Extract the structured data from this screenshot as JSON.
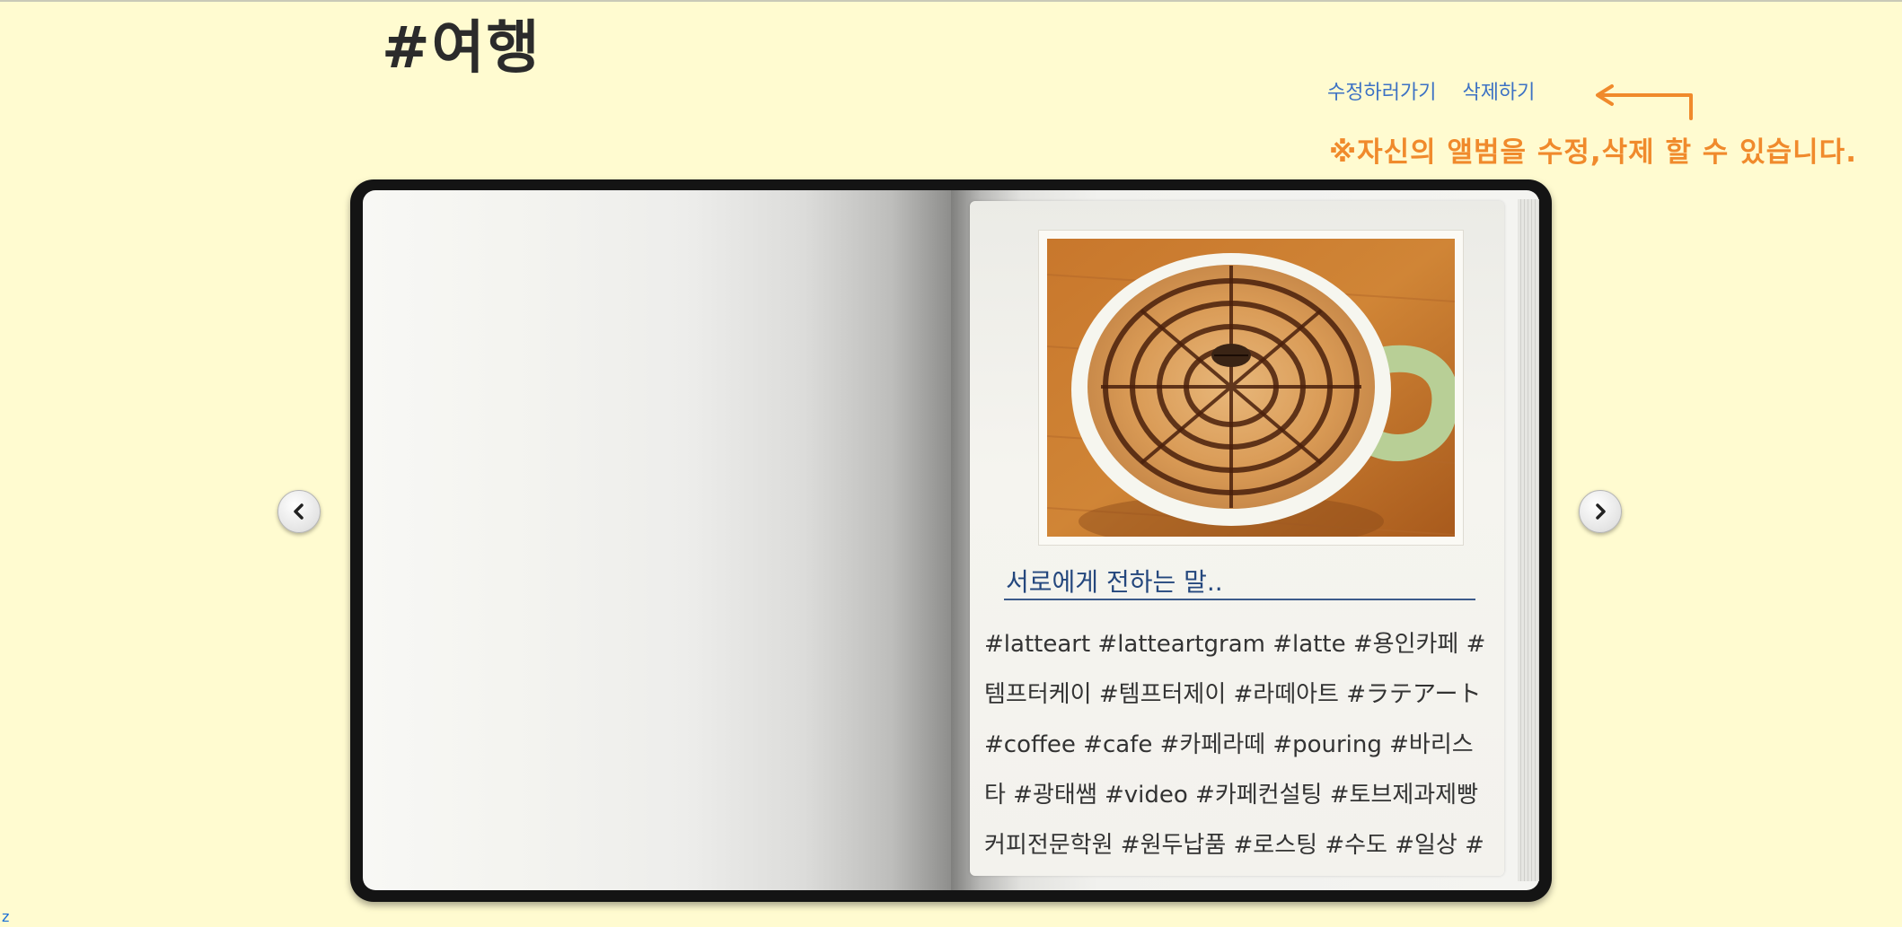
{
  "album": {
    "title": "#여행"
  },
  "actions": {
    "edit_label": "수정하러가기",
    "delete_label": "삭제하기"
  },
  "notice": {
    "text": "※자신의 앨범을 수정,삭제 할 수 있습니다."
  },
  "book": {
    "caption": "서로에게 전하는 말..",
    "hashtags": "#latteart #latteartgram #latte #용인카페 #템프터케이 #템프터제이 #라떼아트 #ラテアート #coffee #cafe #카페라떼 #pouring #바리스타 #광태쌤 #video #카페컨설팅 #토브제과제빵커피전문학원 #원두납품 #로스팅 #수도 #일상 #카페 #커피스타그램"
  },
  "colors": {
    "background": "#fffbd0",
    "link": "#3d72c4",
    "notice": "#f08a2c",
    "caption": "#24477d"
  },
  "icons": {
    "prev": "chevron-left-icon",
    "next": "chevron-right-icon",
    "arrow": "arrow-left-icon"
  },
  "footer": {
    "marker": "z"
  }
}
